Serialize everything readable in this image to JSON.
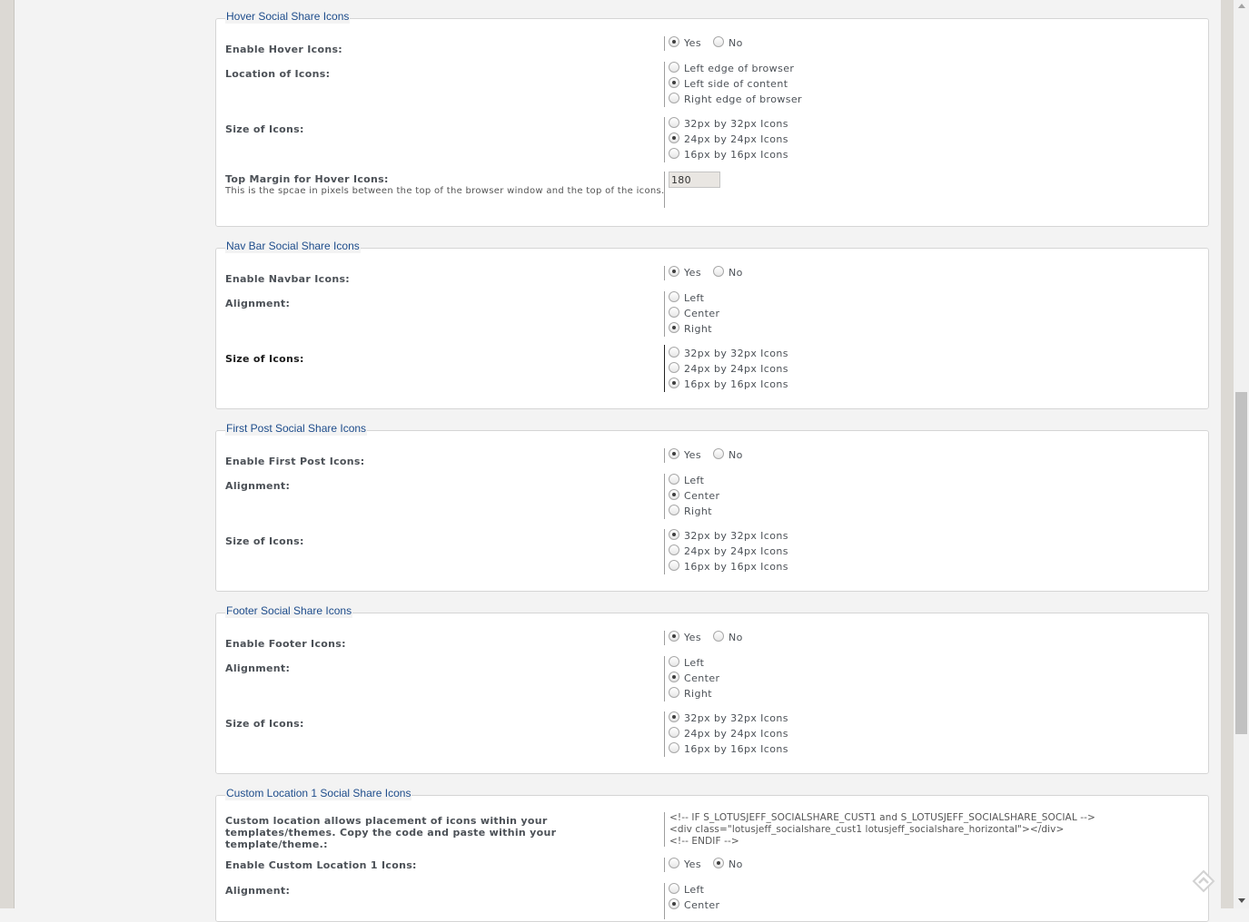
{
  "sections": [
    {
      "legend": "Hover Social Share Icons",
      "rows": [
        {
          "label": "Enable Hover Icons:",
          "options": [
            "Yes",
            "No"
          ],
          "selected": "Yes"
        },
        {
          "label": "Location of Icons:",
          "options": [
            "Left edge of browser",
            "Left side of content",
            "Right edge of browser"
          ],
          "selected": "Left side of content"
        },
        {
          "label": "Size of Icons:",
          "options": [
            "32px by 32px Icons",
            "24px by 24px Icons",
            "16px by 16px Icons"
          ],
          "selected": "24px by 24px Icons"
        },
        {
          "label": "Top Margin for Hover Icons:",
          "description": "This is the spcae in pixels between the top of the browser window and the top of the icons.",
          "value": "180"
        }
      ]
    },
    {
      "legend": "Nav Bar Social Share Icons",
      "rows": [
        {
          "label": "Enable Navbar Icons:",
          "options": [
            "Yes",
            "No"
          ],
          "selected": "Yes"
        },
        {
          "label": "Alignment:",
          "options": [
            "Left",
            "Center",
            "Right"
          ],
          "selected": "Right"
        },
        {
          "label": "Size of Icons:",
          "options": [
            "32px by 32px Icons",
            "24px by 24px Icons",
            "16px by 16px Icons"
          ],
          "selected": "16px by 16px Icons"
        }
      ]
    },
    {
      "legend": "First Post Social Share Icons",
      "rows": [
        {
          "label": "Enable First Post Icons:",
          "options": [
            "Yes",
            "No"
          ],
          "selected": "Yes"
        },
        {
          "label": "Alignment:",
          "options": [
            "Left",
            "Center",
            "Right"
          ],
          "selected": "Center"
        },
        {
          "label": "Size of Icons:",
          "options": [
            "32px by 32px Icons",
            "24px by 24px Icons",
            "16px by 16px Icons"
          ],
          "selected": "32px by 32px Icons"
        }
      ]
    },
    {
      "legend": "Footer Social Share Icons",
      "rows": [
        {
          "label": "Enable Footer Icons:",
          "options": [
            "Yes",
            "No"
          ],
          "selected": "Yes"
        },
        {
          "label": "Alignment:",
          "options": [
            "Left",
            "Center",
            "Right"
          ],
          "selected": "Center"
        },
        {
          "label": "Size of Icons:",
          "options": [
            "32px by 32px Icons",
            "24px by 24px Icons",
            "16px by 16px Icons"
          ],
          "selected": "32px by 32px Icons"
        }
      ]
    },
    {
      "legend": "Custom Location 1 Social Share Icons",
      "rows": [
        {
          "label": "Custom location allows placement of icons within your templates/themes. Copy the code and paste within your template/theme.:",
          "code": [
            "<!-- IF S_LOTUSJEFF_SOCIALSHARE_CUST1 and S_LOTUSJEFF_SOCIALSHARE_SOCIAL -->",
            "<div class=\"lotusjeff_socialshare_cust1 lotusjeff_socialshare_horizontal\"></div>",
            "<!-- ENDIF -->"
          ]
        },
        {
          "label": "Enable Custom Location 1 Icons:",
          "options": [
            "Yes",
            "No"
          ],
          "selected": "No"
        },
        {
          "label": "Alignment:",
          "options": [
            "Left",
            "Center"
          ],
          "selected": "Center"
        }
      ]
    }
  ]
}
